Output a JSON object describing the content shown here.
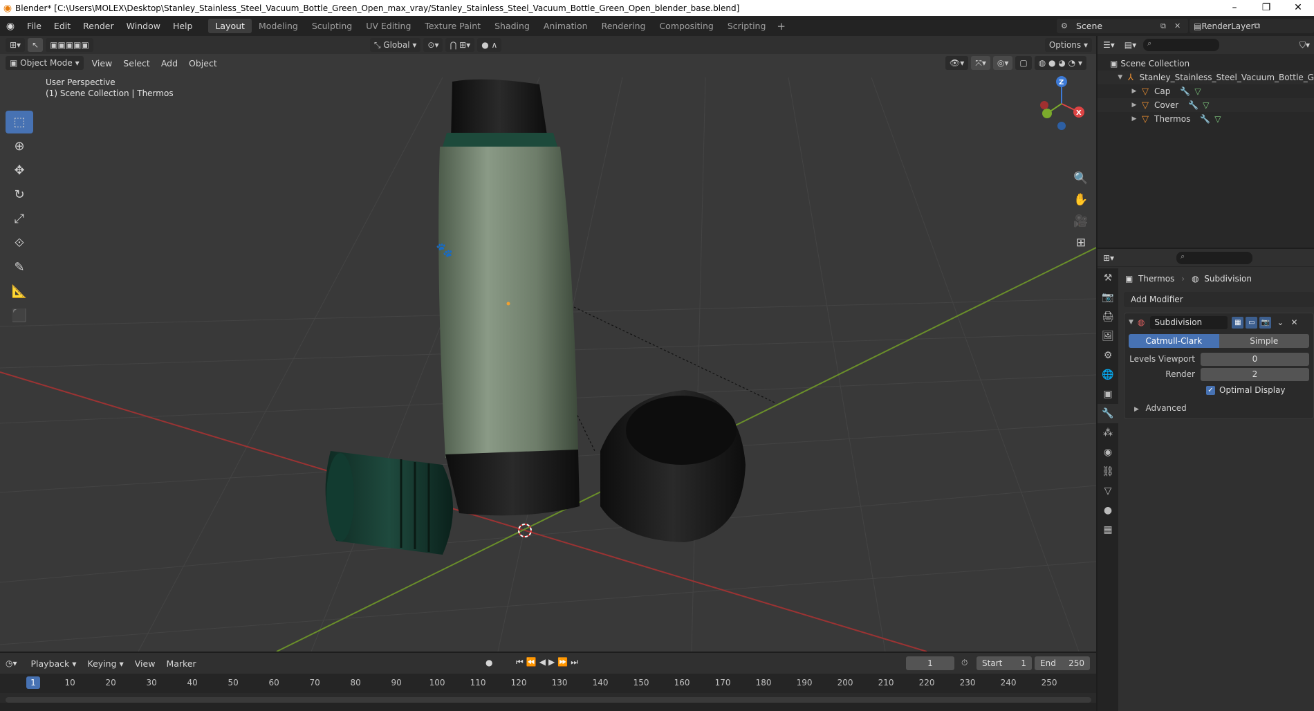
{
  "window": {
    "title": "Blender* [C:\\Users\\MOLEX\\Desktop\\Stanley_Stainless_Steel_Vacuum_Bottle_Green_Open_max_vray/Stanley_Stainless_Steel_Vacuum_Bottle_Green_Open_blender_base.blend]",
    "minimize": "–",
    "restore": "❐",
    "close": "✕"
  },
  "menubar": {
    "menus": [
      "File",
      "Edit",
      "Render",
      "Window",
      "Help"
    ],
    "workspaces": [
      "Layout",
      "Modeling",
      "Sculpting",
      "UV Editing",
      "Texture Paint",
      "Shading",
      "Animation",
      "Rendering",
      "Compositing",
      "Scripting"
    ],
    "active_workspace": "Layout",
    "add_tab": "+",
    "scene": "Scene",
    "render_layer": "RenderLayer"
  },
  "viewport": {
    "transform_orientation": "Global",
    "options_label": "Options",
    "mode": "Object Mode",
    "menus": [
      "View",
      "Select",
      "Add",
      "Object"
    ],
    "perspective_label": "User Perspective",
    "collection_label": "(1) Scene Collection | Thermos",
    "gizmo_x": "X",
    "gizmo_y": "Y",
    "gizmo_z": "Z"
  },
  "outliner": {
    "root": "Scene Collection",
    "collection": "Stanley_Stainless_Steel_Vacuum_Bottle_Gre",
    "objects": [
      "Cap",
      "Cover",
      "Thermos"
    ]
  },
  "properties": {
    "object_name": "Thermos",
    "modifier_context": "Subdivision",
    "add_modifier_label": "Add Modifier",
    "modifier": {
      "name": "Subdivision",
      "types": [
        "Catmull-Clark",
        "Simple"
      ],
      "active_type": "Catmull-Clark",
      "levels_viewport_label": "Levels Viewport",
      "levels_viewport": "0",
      "render_label": "Render",
      "render": "2",
      "optimal_display_label": "Optimal Display",
      "optimal_display": true,
      "advanced_label": "Advanced"
    }
  },
  "timeline": {
    "menus": [
      "Playback",
      "Keying",
      "View",
      "Marker"
    ],
    "current_frame": "1",
    "start_label": "Start",
    "start": "1",
    "end_label": "End",
    "end": "250",
    "ticks": [
      "10",
      "20",
      "30",
      "40",
      "50",
      "60",
      "70",
      "80",
      "90",
      "100",
      "110",
      "120",
      "130",
      "140",
      "150",
      "160",
      "170",
      "180",
      "190",
      "200",
      "210",
      "220",
      "230",
      "240",
      "250"
    ]
  },
  "colors": {
    "accent": "#4772b3",
    "axis_x": "#c93a3a",
    "axis_y": "#7bab2c",
    "object_orange": "#e88d31"
  }
}
